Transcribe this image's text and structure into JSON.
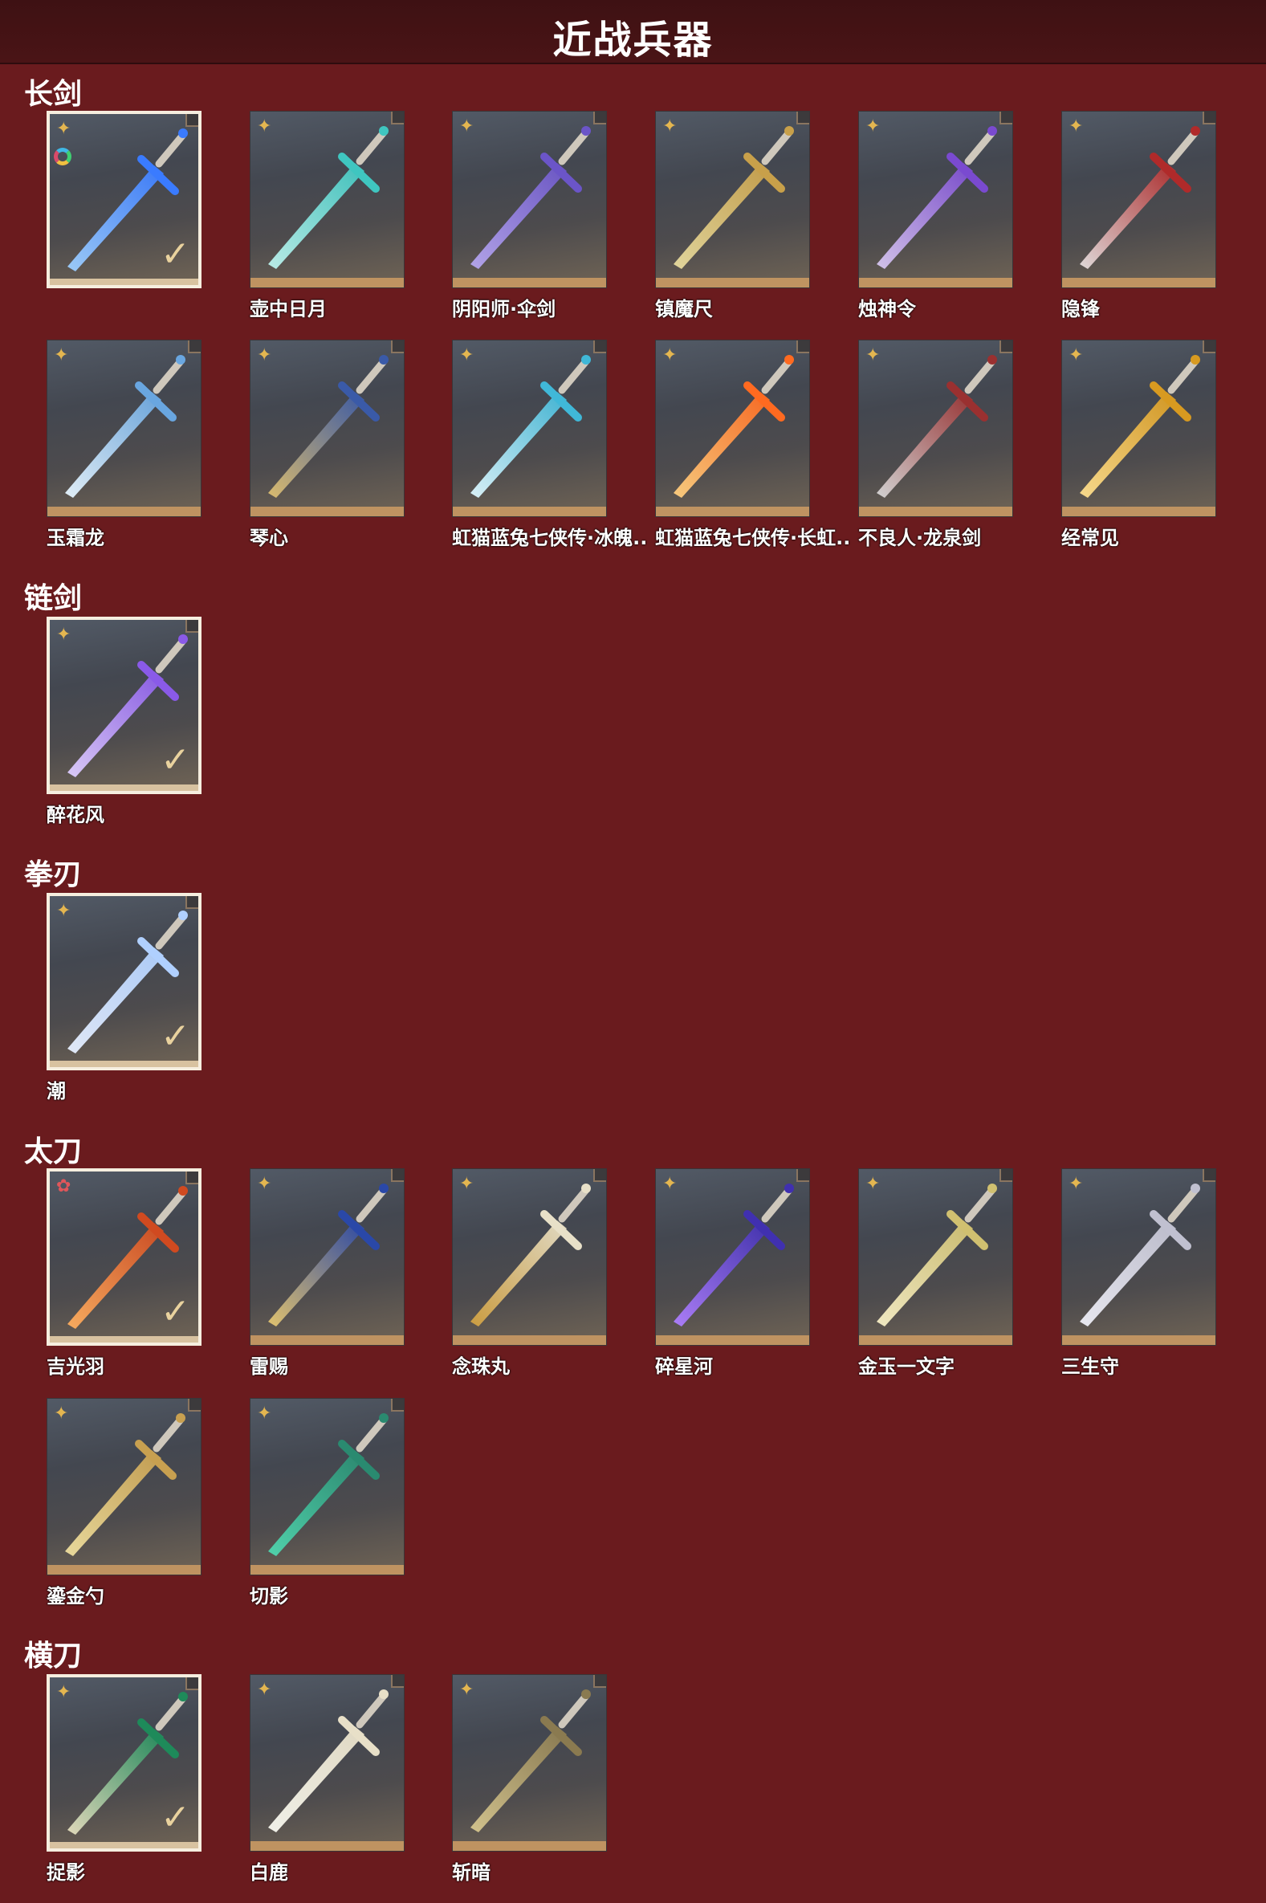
{
  "header": {
    "title": "近战兵器"
  },
  "colors": {
    "background": "#6a1b1e",
    "header": "#3e1113",
    "card_bottom_bar": "#bf9361",
    "selected_border": "#f6eedf"
  },
  "sections": [
    {
      "title": "长剑",
      "items": [
        {
          "name": "",
          "selected": true,
          "badge_icon": "gold-star-icon",
          "dye_icon": true
        },
        {
          "name": "壶中日月",
          "badge_icon": "gold-star-icon"
        },
        {
          "name": "阴阳师·伞剑",
          "badge_icon": "gold-star-icon"
        },
        {
          "name": "镇魔尺",
          "badge_icon": "gold-star-icon"
        },
        {
          "name": "烛神令",
          "badge_icon": "gold-star-icon"
        },
        {
          "name": "隐锋",
          "badge_icon": "gold-star-icon"
        },
        {
          "name": "玉霜龙",
          "badge_icon": "gold-star-icon"
        },
        {
          "name": "琴心",
          "badge_icon": "gold-star-icon"
        },
        {
          "name": "虹猫蓝兔七侠传·冰魄..",
          "badge_icon": "gold-star-icon"
        },
        {
          "name": "虹猫蓝兔七侠传·长虹..",
          "badge_icon": "gold-star-icon"
        },
        {
          "name": "不良人·龙泉剑",
          "badge_icon": "gold-star-icon"
        },
        {
          "name": "经常见",
          "badge_icon": "gold-star-icon"
        }
      ]
    },
    {
      "title": "链剑",
      "items": [
        {
          "name": "醉花风",
          "selected": true,
          "badge_icon": "gold-star-icon"
        }
      ]
    },
    {
      "title": "拳刃",
      "items": [
        {
          "name": "潮",
          "selected": true,
          "badge_icon": "gold-star-icon"
        }
      ]
    },
    {
      "title": "太刀",
      "items": [
        {
          "name": "吉光羽",
          "selected": true,
          "badge_icon": "red-star-icon"
        },
        {
          "name": "雷赐",
          "badge_icon": "gold-star-icon"
        },
        {
          "name": "念珠丸",
          "badge_icon": "gold-star-icon"
        },
        {
          "name": "碎星河",
          "badge_icon": "gold-star-icon"
        },
        {
          "name": "金玉一文字",
          "badge_icon": "gold-star-icon"
        },
        {
          "name": "三生守",
          "badge_icon": "gold-star-icon"
        },
        {
          "name": "鎏金勺",
          "badge_icon": "gold-star-icon"
        },
        {
          "name": "切影",
          "badge_icon": "gold-star-icon"
        }
      ]
    },
    {
      "title": "横刀",
      "items": [
        {
          "name": "捉影",
          "selected": true,
          "badge_icon": "gold-star-icon"
        },
        {
          "name": "白鹿",
          "badge_icon": "gold-star-icon"
        },
        {
          "name": "斩暗",
          "badge_icon": "gold-star-icon"
        }
      ]
    }
  ]
}
